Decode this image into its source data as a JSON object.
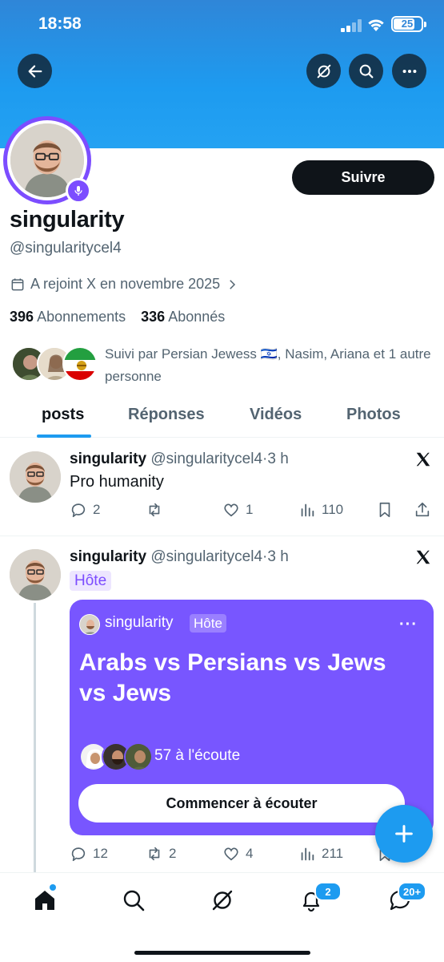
{
  "status_bar": {
    "time": "18:58",
    "battery": "25"
  },
  "header": {
    "back_icon": "arrow-left-icon",
    "grok_icon": "grok-icon",
    "search_icon": "search-icon",
    "more_icon": "more-horizontal-icon",
    "banner_color": "#1d9bf0"
  },
  "profile": {
    "name": "singularity",
    "handle": "@singularitycel4",
    "joined": "A rejoint X en novembre 2025",
    "following_count": "396",
    "following_label": "Abonnements",
    "followers_count": "336",
    "followers_label": "Abonnés",
    "followed_by": "Suivi par Persian Jewess 🇮🇱, Nasim, Ariana et 1 autre personne",
    "follow_button": "Suivre",
    "accent": "#7c4dff"
  },
  "tabs": [
    "posts",
    "Réponses",
    "Vidéos",
    "Photos"
  ],
  "posts": [
    {
      "author": "singularity",
      "handle": "@singularitycel4",
      "sep": "·",
      "time": "3 h",
      "text": "Pro humanity",
      "replies": "2",
      "reposts": "",
      "likes": "1",
      "views": "110"
    },
    {
      "author": "singularity",
      "handle": "@singularitycel4",
      "sep": "·",
      "time": "3 h",
      "host_tag": "Hôte",
      "space": {
        "host_name": "singularity",
        "host_tag": "Hôte",
        "more": "···",
        "title": "Arabs vs Persians vs Jews vs Jews",
        "listeners": "57 à l'écoute",
        "button": "Commencer à écouter",
        "color": "#7856ff"
      },
      "replies": "12",
      "reposts": "2",
      "likes": "4",
      "views": "211"
    }
  ],
  "fab_icon": "plus-icon",
  "bottom_nav": {
    "notifications_badge": "2",
    "messages_badge": "20+"
  }
}
